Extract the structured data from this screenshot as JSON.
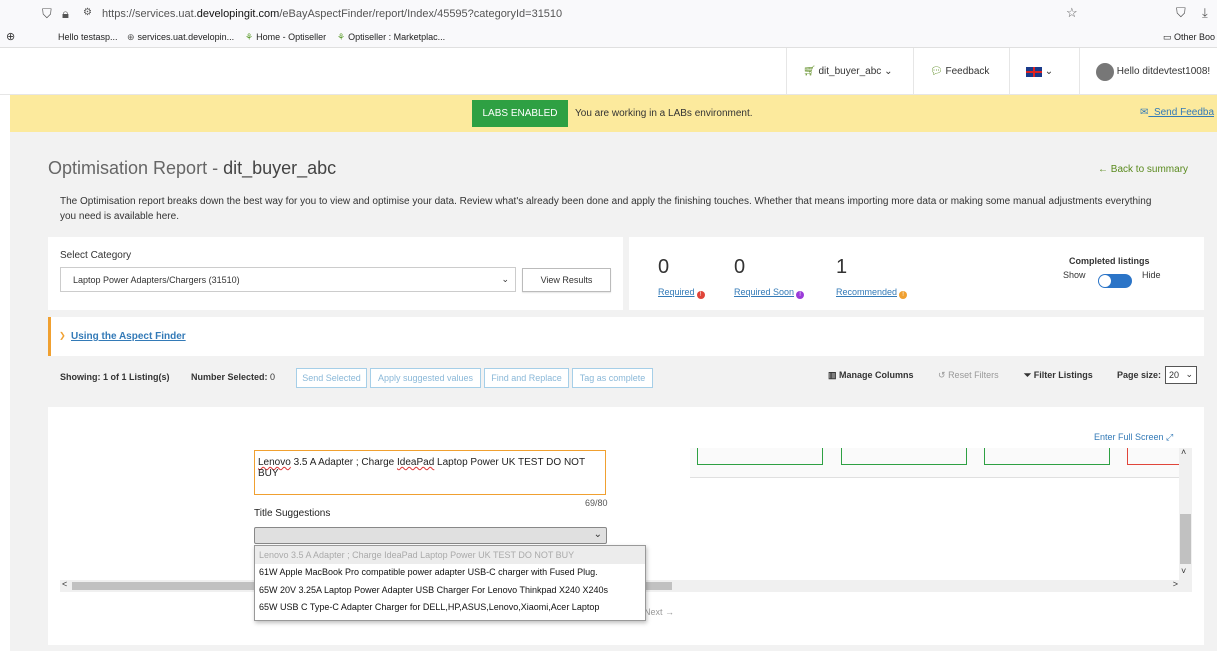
{
  "browser": {
    "url_prefix": "https://services.uat.",
    "url_domain": "developingit.com",
    "url_path": "/eBayAspectFinder/report/Index/45595?categoryId=31510",
    "bookmarks": [
      "Hello testasp...",
      "services.uat.developin...",
      "Home - Optiseller",
      "Optiseller : Marketplac..."
    ],
    "other_bookmarks": "Other Boo"
  },
  "header": {
    "account": "dit_buyer_abc",
    "feedback": "Feedback",
    "user": "Hello ditdevtest1008!"
  },
  "labs": {
    "badge": "LABS ENABLED",
    "message": "You are working in a LABs environment.",
    "send_feedback": "Send Feedba"
  },
  "report": {
    "title_prefix": "Optimisation Report - ",
    "title_account": "dit_buyer_abc",
    "back": "Back to summary",
    "description": "The Optimisation report breaks down the best way for you to view and optimise your data. Review what's already been done and apply the finishing touches. Whether that means importing more data or making some manual adjustments everything you need is available here."
  },
  "category": {
    "label": "Select Category",
    "selected": "Laptop Power Adapters/Chargers (31510)",
    "view_results": "View Results"
  },
  "stats": {
    "required": {
      "value": "0",
      "label": "Required"
    },
    "required_soon": {
      "value": "0",
      "label": "Required Soon"
    },
    "recommended": {
      "value": "1",
      "label": "Recommended"
    },
    "completed_label": "Completed listings",
    "show": "Show",
    "hide": "Hide"
  },
  "guide": {
    "link": "Using the Aspect Finder"
  },
  "toolbar": {
    "showing": "Showing: 1 of 1 Listing(s)",
    "number_selected_label": "Number Selected:",
    "number_selected_value": "0",
    "send_selected": "Send Selected",
    "apply_suggested": "Apply suggested values",
    "find_replace": "Find and Replace",
    "tag_complete": "Tag as complete",
    "manage_columns": "Manage Columns",
    "reset_filters": "Reset Filters",
    "filter_listings": "Filter Listings",
    "page_size_label": "Page size:",
    "page_size_value": "20"
  },
  "grid": {
    "enter_full_screen": "Enter Full Screen",
    "title_word1": "Lenovo",
    "title_mid": " 3.5 A Adapter ; Charge ",
    "title_word2": "IdeaPad",
    "title_rest": " Laptop Power UK TEST DO NOT BUY",
    "char_count": "69/80",
    "suggestions_label": "Title Suggestions",
    "options": [
      "Lenovo 3.5 A Adapter ; Charge IdeaPad Laptop Power UK TEST DO NOT BUY",
      "61W Apple MacBook Pro compatible power adapter USB-C charger with Fused Plug.",
      "65W 20V 3.25A Laptop Power Adapter USB Charger For Lenovo Thinkpad X240 X240s",
      "65W USB C Type-C Adapter Charger for DELL,HP,ASUS,Lenovo,Xiaomi,Acer Laptop"
    ],
    "next": "Next"
  },
  "colors": {
    "accent_green": "#2ea043",
    "link_blue": "#337ab7",
    "labs_yellow": "#fcea9d",
    "warning_orange": "#f0a030"
  }
}
